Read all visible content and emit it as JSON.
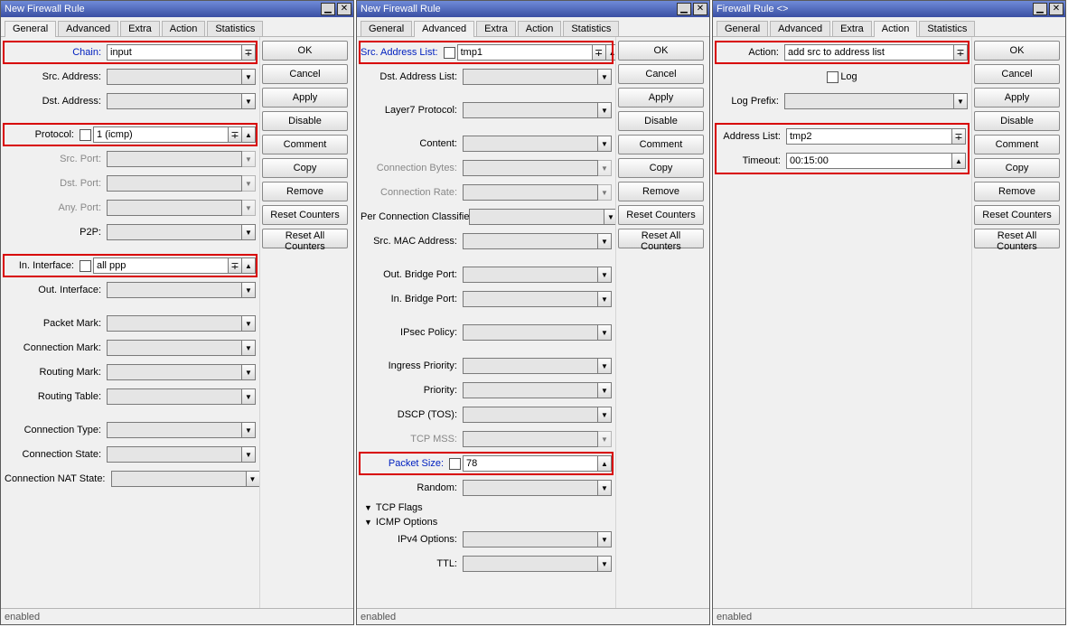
{
  "win1": {
    "title": "New Firewall Rule",
    "tabs": [
      "General",
      "Advanced",
      "Extra",
      "Action",
      "Statistics"
    ],
    "active_tab": 0,
    "fields": {
      "chain": "input",
      "src_address": "",
      "dst_address": "",
      "protocol": "1 (icmp)",
      "src_port": "",
      "dst_port": "",
      "any_port": "",
      "p2p": "",
      "in_interface": "all ppp",
      "out_interface": "",
      "packet_mark": "",
      "connection_mark": "",
      "routing_mark": "",
      "routing_table": "",
      "connection_type": "",
      "connection_state": "",
      "connection_nat_state": ""
    },
    "labels": {
      "chain": "Chain:",
      "src_address": "Src. Address:",
      "dst_address": "Dst. Address:",
      "protocol": "Protocol:",
      "src_port": "Src. Port:",
      "dst_port": "Dst. Port:",
      "any_port": "Any. Port:",
      "p2p": "P2P:",
      "in_interface": "In. Interface:",
      "out_interface": "Out. Interface:",
      "packet_mark": "Packet Mark:",
      "connection_mark": "Connection Mark:",
      "routing_mark": "Routing Mark:",
      "routing_table": "Routing Table:",
      "connection_type": "Connection Type:",
      "connection_state": "Connection State:",
      "connection_nat_state": "Connection NAT State:"
    },
    "buttons": [
      "OK",
      "Cancel",
      "Apply",
      "Disable",
      "Comment",
      "Copy",
      "Remove",
      "Reset Counters",
      "Reset All Counters"
    ],
    "status": "enabled"
  },
  "win2": {
    "title": "New Firewall Rule",
    "tabs": [
      "General",
      "Advanced",
      "Extra",
      "Action",
      "Statistics"
    ],
    "active_tab": 1,
    "fields": {
      "src_address_list": "tmp1",
      "dst_address_list": "",
      "layer7": "",
      "content": "",
      "connection_bytes": "",
      "connection_rate": "",
      "per_conn_classifier": "",
      "src_mac": "",
      "out_bridge_port": "",
      "in_bridge_port": "",
      "ipsec_policy": "",
      "ingress_priority": "",
      "priority": "",
      "dscp": "",
      "tcp_mss": "",
      "packet_size": "78",
      "random": "",
      "ipv4_options": "",
      "ttl": ""
    },
    "labels": {
      "src_address_list": "Src. Address List:",
      "dst_address_list": "Dst. Address List:",
      "layer7": "Layer7 Protocol:",
      "content": "Content:",
      "connection_bytes": "Connection Bytes:",
      "connection_rate": "Connection Rate:",
      "per_conn_classifier": "Per Connection Classifier:",
      "src_mac": "Src. MAC Address:",
      "out_bridge_port": "Out. Bridge Port:",
      "in_bridge_port": "In. Bridge Port:",
      "ipsec_policy": "IPsec Policy:",
      "ingress_priority": "Ingress Priority:",
      "priority": "Priority:",
      "dscp": "DSCP (TOS):",
      "tcp_mss": "TCP MSS:",
      "packet_size": "Packet Size:",
      "random": "Random:",
      "tcp_flags": "TCP Flags",
      "icmp_options": "ICMP Options",
      "ipv4_options": "IPv4 Options:",
      "ttl": "TTL:"
    },
    "buttons": [
      "OK",
      "Cancel",
      "Apply",
      "Disable",
      "Comment",
      "Copy",
      "Remove",
      "Reset Counters",
      "Reset All Counters"
    ],
    "status": "enabled"
  },
  "win3": {
    "title": "Firewall Rule <>",
    "tabs": [
      "General",
      "Advanced",
      "Extra",
      "Action",
      "Statistics"
    ],
    "active_tab": 3,
    "fields": {
      "action": "add src to address list",
      "log_prefix": "",
      "address_list": "tmp2",
      "timeout": "00:15:00"
    },
    "labels": {
      "action": "Action:",
      "log": "Log",
      "log_prefix": "Log Prefix:",
      "address_list": "Address List:",
      "timeout": "Timeout:"
    },
    "buttons": [
      "OK",
      "Cancel",
      "Apply",
      "Disable",
      "Comment",
      "Copy",
      "Remove",
      "Reset Counters",
      "Reset All Counters"
    ],
    "status": "enabled"
  }
}
